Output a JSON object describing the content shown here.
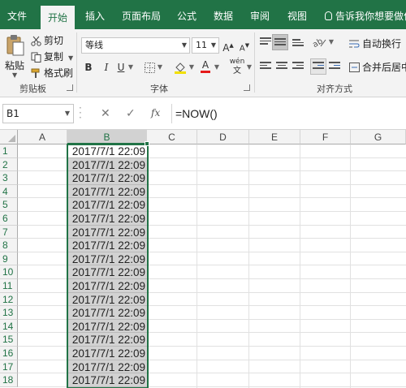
{
  "ribbon": {
    "tabs": [
      "文件",
      "开始",
      "插入",
      "页面布局",
      "公式",
      "数据",
      "审阅",
      "视图"
    ],
    "active_tab": "开始",
    "tell_me": "告诉我你想要做什么"
  },
  "clipboard": {
    "paste": "粘贴",
    "cut": "剪切",
    "copy": "复制",
    "format_painter": "格式刷",
    "group_label": "剪贴板"
  },
  "font": {
    "name": "等线",
    "size": "11",
    "bold": "B",
    "italic": "I",
    "underline": "U",
    "grow": "A",
    "shrink": "A",
    "font_color": "A",
    "phonetic": "wén",
    "group_label": "字体"
  },
  "alignment": {
    "wrap_text": "自动换行",
    "merge_center": "合并后居中",
    "group_label": "对齐方式"
  },
  "formula_bar": {
    "name_box": "B1",
    "formula": "=NOW()",
    "fx": "fx"
  },
  "sheet": {
    "columns": [
      "A",
      "B",
      "C",
      "D",
      "E",
      "F",
      "G"
    ],
    "selected_column": "B",
    "rows": [
      "1",
      "2",
      "3",
      "4",
      "5",
      "6",
      "7",
      "8",
      "9",
      "10",
      "11",
      "12",
      "13",
      "14",
      "15",
      "16",
      "17",
      "18"
    ],
    "b_values": [
      "2017/7/1 22:09",
      "2017/7/1 22:09",
      "2017/7/1 22:09",
      "2017/7/1 22:09",
      "2017/7/1 22:09",
      "2017/7/1 22:09",
      "2017/7/1 22:09",
      "2017/7/1 22:09",
      "2017/7/1 22:09",
      "2017/7/1 22:09",
      "2017/7/1 22:09",
      "2017/7/1 22:09",
      "2017/7/1 22:09",
      "2017/7/1 22:09",
      "2017/7/1 22:09",
      "2017/7/1 22:09",
      "2017/7/1 22:09",
      "2017/7/1 22:09"
    ]
  },
  "colors": {
    "excel_green": "#217346",
    "selection_fill": "#d2d2d2"
  }
}
